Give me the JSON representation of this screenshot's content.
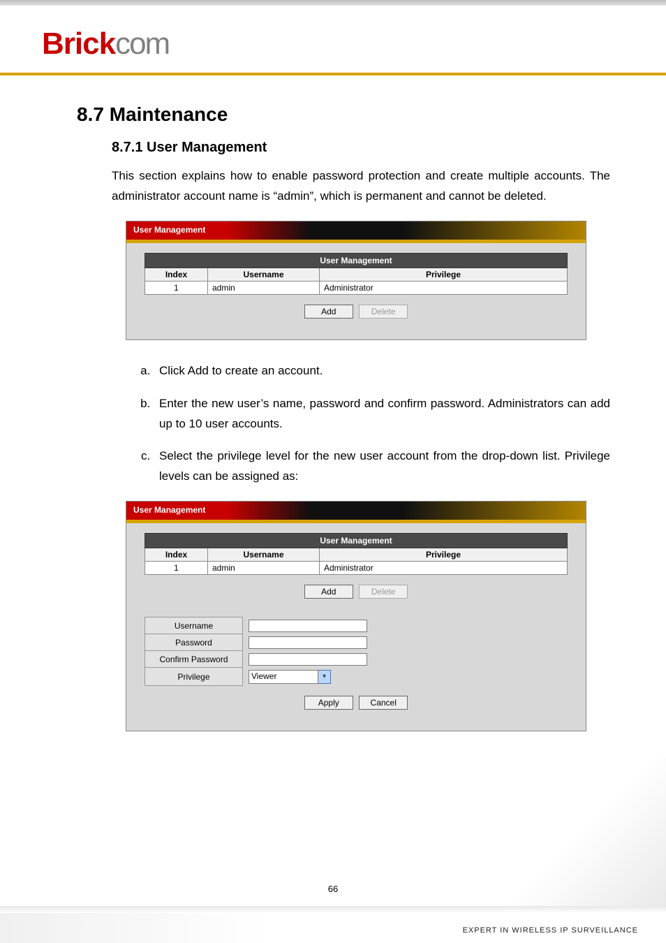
{
  "brand": {
    "brick": "Brick",
    "com": "com"
  },
  "headings": {
    "maintenance": "8.7 Maintenance",
    "user_management": "8.7.1   User Management"
  },
  "intro": "This section explains how to enable password protection and create multiple accounts.  The administrator account name is “admin”, which is permanent and cannot be deleted.",
  "panel": {
    "title": "User Management",
    "group_header": "User Management",
    "cols": {
      "index": "Index",
      "username": "Username",
      "privilege": "Privilege"
    },
    "rows": [
      {
        "index": "1",
        "username": "admin",
        "privilege": "Administrator"
      }
    ],
    "buttons": {
      "add": "Add",
      "delete": "Delete",
      "apply": "Apply",
      "cancel": "Cancel"
    }
  },
  "steps": {
    "a": "Click Add to create an account.",
    "b": "Enter the new user’s name, password and confirm password. Administrators can add up to 10 user accounts.",
    "c": "Select the privilege level for the new user account from the drop-down list. Privilege levels can be assigned as:"
  },
  "form": {
    "labels": {
      "username": "Username",
      "password": "Password",
      "confirm": "Confirm Password",
      "privilege": "Privilege"
    },
    "privilege_selected": "Viewer"
  },
  "page_number": "66",
  "footer": "EXPERT IN WIRELESS IP SURVEILLANCE"
}
